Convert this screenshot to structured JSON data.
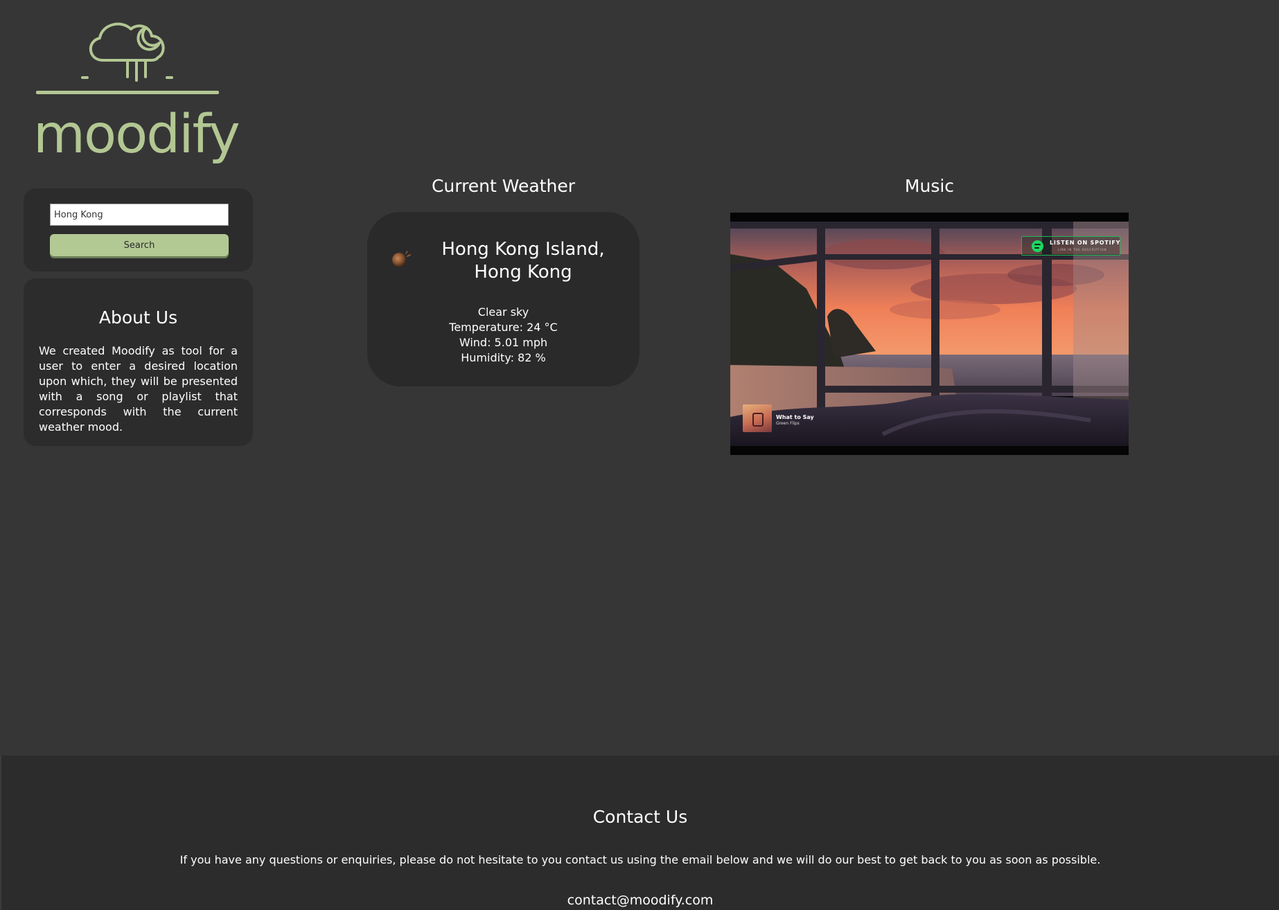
{
  "brand": {
    "name": "moodify",
    "logo_icon": "cloud-rain-moon-icon",
    "color": "#b3c793"
  },
  "search": {
    "value": "Hong Kong",
    "placeholder": "",
    "button_label": "Search",
    "button_color": "#b2c994"
  },
  "about": {
    "title": "About Us",
    "text": "We created Moodify as tool for a user to enter a desired location upon which, they will be presented with a song or playlist that corresponds with the current weather mood."
  },
  "weather": {
    "section_title": "Current Weather",
    "location": "Hong Kong Island, Hong Kong",
    "icon": "clear-sky-icon",
    "description": "Clear sky",
    "temperature": "Temperature: 24 °C",
    "wind": "Wind: 5.01 mph",
    "humidity": "Humidity: 82 %"
  },
  "music": {
    "section_title": "Music",
    "badge_text": "LISTEN ON SPOTIFY",
    "badge_subtext": "LINK IN THE DESCRIPTION",
    "song_title": "What to Say",
    "song_artist": "Green Flips",
    "spotify_color": "#1ed760"
  },
  "footer": {
    "title": "Contact Us",
    "text": "If you have any questions or enquiries, please do not hesitate to you contact us using the email below and we will do our best to get back to you as soon as possible.",
    "email": "contact@moodify.com"
  }
}
